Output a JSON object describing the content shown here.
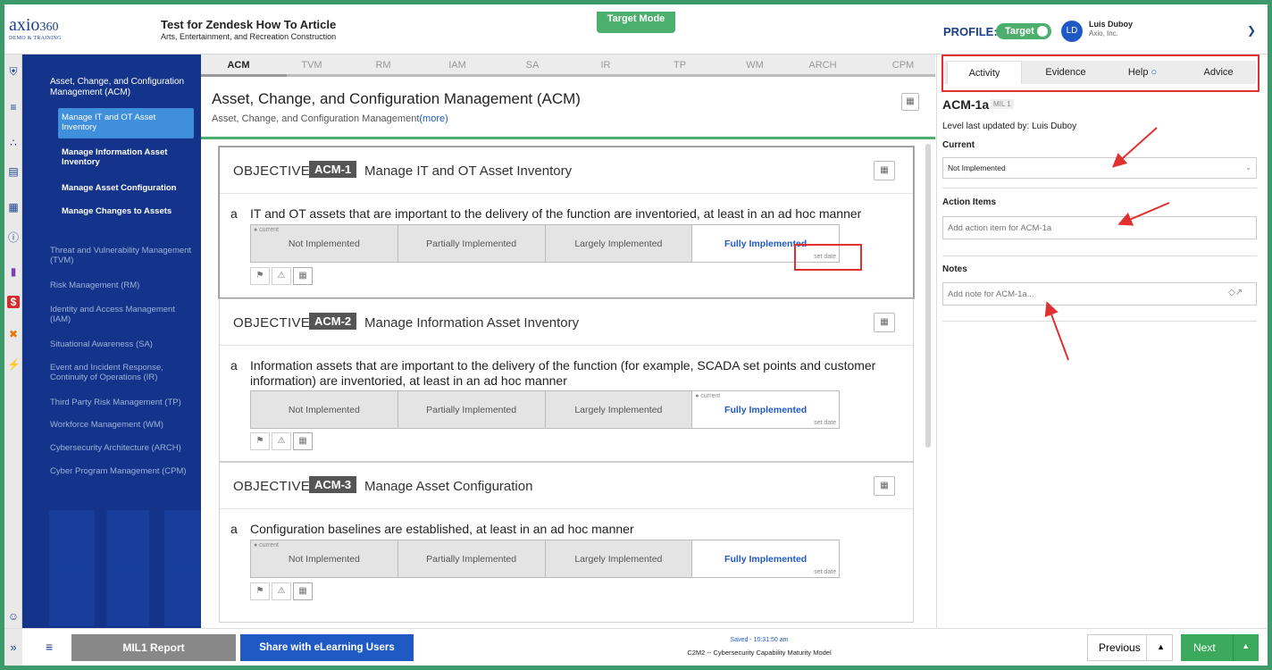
{
  "header": {
    "logo_main": "axio",
    "logo_num": "360",
    "logo_sub": "DEMO & TRAINING",
    "assessment_title": "Test for Zendesk How To Article",
    "assessment_sub": "Arts, Entertainment, and Recreation  Construction",
    "mode_badge": "Target Mode",
    "profile_label": "PROFILE:",
    "profile_toggle": "Target",
    "avatar_initials": "LD",
    "user_name": "Luis Duboy",
    "user_org": "Axio, Inc."
  },
  "sidebar": {
    "current_domain": "Asset, Change, and Configuration Management (ACM)",
    "practices": [
      {
        "label": "Manage IT and OT Asset Inventory"
      },
      {
        "label": "Manage Information Asset Inventory"
      },
      {
        "label": "Manage Asset Configuration"
      },
      {
        "label": "Manage Changes to Assets"
      }
    ],
    "domains": [
      {
        "label": "Threat and Vulnerability Management (TVM)"
      },
      {
        "label": "Risk Management (RM)"
      },
      {
        "label": "Identity and Access Management (IAM)"
      },
      {
        "label": "Situational Awareness (SA)"
      },
      {
        "label": "Event and Incident Response, Continuity of Operations (IR)"
      },
      {
        "label": "Third Party Risk Management (TP)"
      },
      {
        "label": "Workforce Management (WM)"
      },
      {
        "label": "Cybersecurity Architecture (ARCH)"
      },
      {
        "label": "Cyber Program Management (CPM)"
      }
    ]
  },
  "domain_tabs": [
    "ACM",
    "TVM",
    "RM",
    "IAM",
    "SA",
    "IR",
    "TP",
    "WM",
    "ARCH",
    "CPM"
  ],
  "main": {
    "title": "Asset, Change, and Configuration Management (ACM)",
    "subtitle": "Asset, Change, and Configuration Management",
    "more_link": "(more)",
    "objective_word": "OBJECTIVE",
    "current_tag": "● current",
    "set_date": "set date",
    "levels": [
      "Not Implemented",
      "Partially Implemented",
      "Largely Implemented",
      "Fully Implemented"
    ],
    "objectives": [
      {
        "id": "ACM-1",
        "title": "Manage IT and OT Asset Inventory",
        "practice_letter": "a",
        "practice_text": "IT and OT assets that are important to the delivery of the function are inventoried, at least in an ad hoc manner"
      },
      {
        "id": "ACM-2",
        "title": "Manage Information Asset Inventory",
        "practice_letter": "a",
        "practice_text": "Information assets that are important to the delivery of the function (for example, SCADA set points and customer information) are inventoried, at least in an ad hoc manner"
      },
      {
        "id": "ACM-3",
        "title": "Manage Asset Configuration",
        "practice_letter": "a",
        "practice_text": "Configuration baselines are established, at least in an ad hoc manner"
      }
    ]
  },
  "right_panel": {
    "tabs": [
      "Activity",
      "Evidence",
      "Help",
      "Advice"
    ],
    "practice_id": "ACM-1a",
    "mil": "MIL 1",
    "last_updated": "Level last updated by: Luis Duboy",
    "current_label": "Current",
    "current_value": "Not Implemented",
    "action_label": "Action Items",
    "action_placeholder": "Add action item for ACM-1a",
    "notes_label": "Notes",
    "notes_placeholder": "Add note for ACM-1a..."
  },
  "footer": {
    "report_button": "MIL1 Report",
    "share_button": "Share with eLearning Users",
    "saved": "Saved - 10:31:50 am",
    "model": "C2M2 -- Cybersecurity Capability Maturity Model",
    "previous": "Previous",
    "next": "Next"
  },
  "colors": {
    "brand": "#1b3f8b",
    "sidebar": "#13348a",
    "accent_green": "#4caf6e",
    "annotation_red": "#e03030"
  }
}
